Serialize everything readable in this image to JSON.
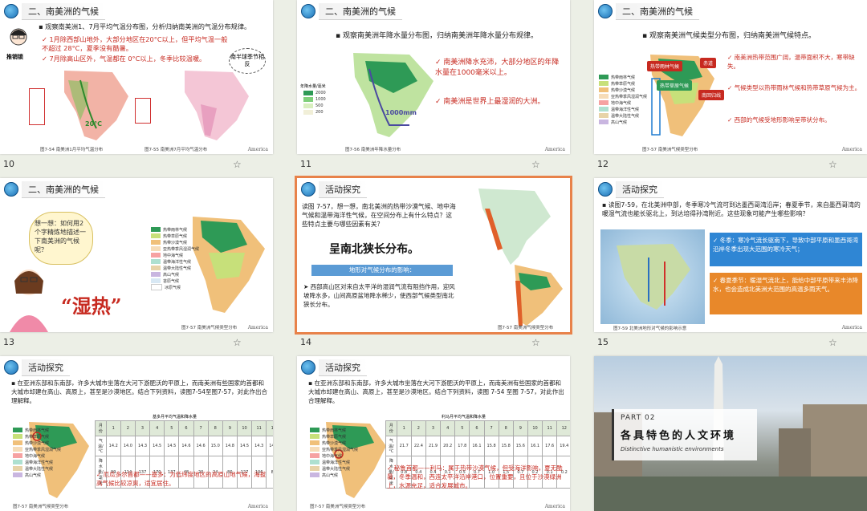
{
  "slides": [
    {
      "num": "10",
      "title": "二、南美洲的气候",
      "intro": "观察南美洲1、7月平均气温分布图，分析归纳南美洲的气温分布规律。",
      "points": [
        "1月除西部山地外，大部分地区在20°C以上，但平均气温一般不超过 28°C，夏季没有酷暑。",
        "7月除高山区外，气温都在 0°C以上，冬季比较温暖。"
      ],
      "bubble": "南半球季节相反",
      "figure_label": "推销锁",
      "iso": "20°C",
      "caption1": "图7-54  南美洲1月平均气温分布",
      "caption2": "图7-55  南美洲7月平均气温分布",
      "footer": "America"
    },
    {
      "num": "11",
      "title": "二、南美洲的气候",
      "intro": "观察南美洲年降水量分布图，归纳南美洲年降水量分布规律。",
      "points": [
        "南美洲降水充沛，大部分地区的年降水量在1000毫米以上。",
        "南美洲是世界上最湿润的大洲。"
      ],
      "legend_title": "年降水量/毫米",
      "legend": [
        "2000",
        "1000",
        "500",
        "200"
      ],
      "iso": "1000mm",
      "caption": "图7-56  南美洲年降水量分布",
      "footer": "America"
    },
    {
      "num": "12",
      "title": "二、南美洲的气候",
      "intro": "观察南美洲气候类型分布图，归纳南美洲气候特点。",
      "points": [
        "南美洲热带范围广阔，温带面积不大，寒带缺失。",
        "气候类型以热带雨林气候和热带草原气候为主。",
        "西部的气候受地形影响呈带状分布。"
      ],
      "tags": [
        "热带雨林气候",
        "热带草原气候",
        "赤道",
        "南回归线"
      ],
      "caption": "图7-57  南美洲气候类型分布",
      "footer": "America"
    },
    {
      "num": "13",
      "title": "二、南美洲的气候",
      "think": "想一想：如何用2个字精炼地描述一下南美洲的气候呢？",
      "answer": "“湿热”",
      "caption": "图7-57  南美洲气候类型分布",
      "footer": "America"
    },
    {
      "num": "14",
      "title": "活动探究",
      "intro": "读图 7-57，想一想，南北美洲的热带沙漠气候、地中海气候和温带海洋性气候，在空间分布上有什么特点？这些特点主要与哪些因素有关？",
      "handwritten": "呈南北狭长分布。",
      "box_title": "地形对气候分布的影响：",
      "explain": "西部高山区对来自太平洋的湿润气流有阻挡作用，迎风坡降水多，山间高原盆地降水稀少，使西部气候类型南北狭长分布。",
      "caption": "图7-57  南美洲气候类型分布"
    },
    {
      "num": "15",
      "title": "活动探究",
      "intro": "读图7-59，在北美洲中部，冬季寒冷气流可到达墨西哥湾沿岸；春夏季节，来自墨西哥湾的暖湿气流也能长驱北上，到达培得孙湾附近。这些现象可能产生哪些影响？",
      "box1": "冬季：寒冷气流长驱南下，导致中部平原和墨西哥湾沿岸冬季出现大范围的寒冷天气；",
      "box2": "春夏季节：暖湿气流北上，能给中部平原带来丰沛降水，也会造成北美洲大范围的高温多雨天气。",
      "caption": "图7-59  北美洲地形对气候的影响示意",
      "footer": "America"
    },
    {
      "num": "16",
      "title": "活动探究",
      "intro": "在亚洲东部和东南部，许多大城市坐落在大河下游肥沃的平原上，而南美洲有些国家的首都和大城市却建在高山、高原上，甚至是沙漠地区。结合下列资料，读图7-54至图7-57，对此作出合理解释。",
      "table_title": "基多月平均气温和降水量",
      "table": [
        [
          "月份",
          "1",
          "2",
          "3",
          "4",
          "5",
          "6",
          "7",
          "8",
          "9",
          "10",
          "11",
          "12"
        ],
        [
          "气温/°C",
          "14.2",
          "14.0",
          "14.3",
          "14.5",
          "14.5",
          "14.6",
          "14.6",
          "15.0",
          "14.8",
          "14.5",
          "14.3",
          "14.4"
        ],
        [
          "降水量/毫米",
          "99",
          "114",
          "137",
          "170",
          "137",
          "48",
          "20",
          "24",
          "80",
          "127",
          "106",
          "88"
        ]
      ],
      "point": "厄瓜多尔首都——基多：为低纬度地区的高原山地气候，海拔高气候比较凉爽，适宜居住。",
      "caption": "图7-57  南美洲气候类型分布",
      "footer": "America"
    },
    {
      "num": "17",
      "title": "活动探究",
      "intro": "在亚洲东部和东南部，许多大城市坐落在大河下游肥沃的平原上，而南美洲有些国家的首都和大城市却建在高山、高原上，甚至是沙漠地区。结合下列资料，读图 7-54 至图 7-57，对此作出合理解释。",
      "table_title": "利马月平均气温和降水量",
      "table": [
        [
          "月份",
          "1",
          "2",
          "3",
          "4",
          "5",
          "6",
          "7",
          "8",
          "9",
          "10",
          "11",
          "12"
        ],
        [
          "气温/°C",
          "21.7",
          "22.4",
          "21.9",
          "20.2",
          "17.8",
          "16.1",
          "15.8",
          "15.8",
          "15.6",
          "16.1",
          "17.6",
          "19.4"
        ],
        [
          "降水量/毫米",
          "0.8",
          "0.4",
          "0.4",
          "0.1",
          "0.5",
          "0.7",
          "1.0",
          "1.5",
          "0.7",
          "0.2",
          "0.1",
          "0.2"
        ]
      ],
      "point": "秘鲁首都——利马：属于热带沙漠气候，但受海洋影响，夏无酷暑，冬季温和，西连太平洋沿岸港口，位置重要，且位于沙漠绿洲上，水源充足，适合发展城市。",
      "caption": "图7-57  南美洲气候类型分布",
      "footer": "America"
    },
    {
      "num": "18",
      "part": "PART 02",
      "heading": "各具特色的人文环境",
      "subtitle": "Distinctive humanistic environments"
    }
  ],
  "legend_items": [
    "热带雨林气候",
    "热带草原气候",
    "热带沙漠气候",
    "亚热带季风湿润气候",
    "地中海气候",
    "温带海洋性气候",
    "温带大陆性气候",
    "高山气候",
    "苔原气候",
    "冰原气候"
  ],
  "colors": {
    "accent": "#e8824a",
    "red": "#c72a20",
    "blue": "#1f7bd0",
    "orange": "#e8882a"
  }
}
